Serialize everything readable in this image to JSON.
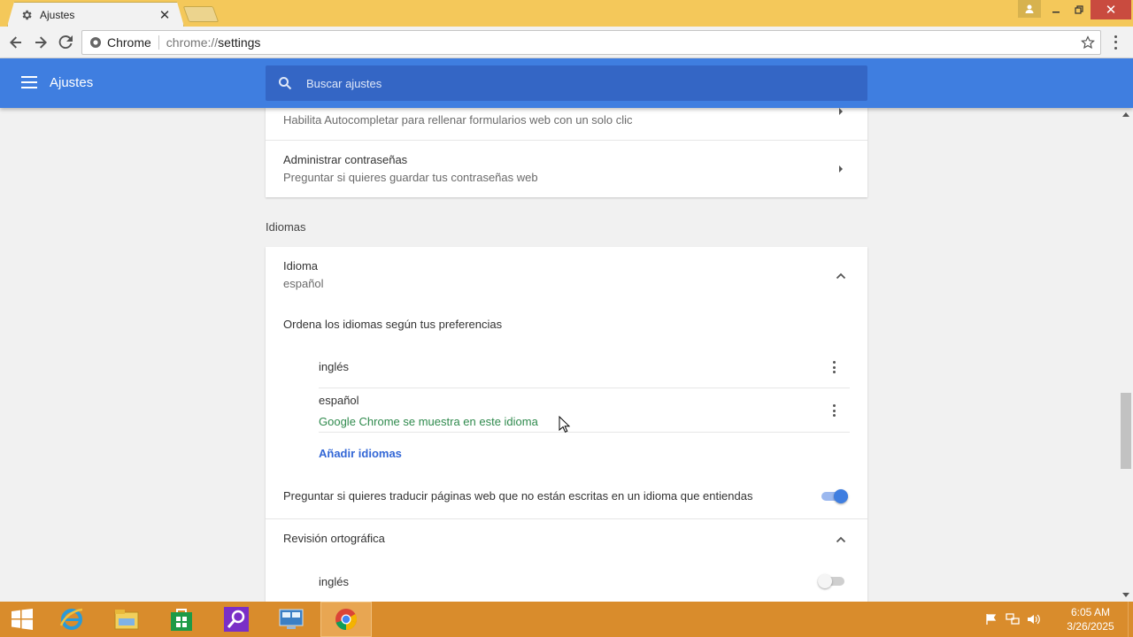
{
  "browser": {
    "tab_title": "Ajustes",
    "omnibox_scheme_label": "Chrome",
    "omnibox_url_prefix": "chrome://",
    "omnibox_url_path": "settings"
  },
  "header": {
    "title": "Ajustes",
    "search_placeholder": "Buscar ajustes"
  },
  "autofill": {
    "autocompletar_secondary": "Habilita Autocompletar para rellenar formularios web con un solo clic",
    "passwords_primary": "Administrar contraseñas",
    "passwords_secondary": "Preguntar si quieres guardar tus contraseñas web"
  },
  "languages": {
    "section_title": "Idiomas",
    "language_label": "Idioma",
    "language_value": "español",
    "order_text": "Ordena los idiomas según tus preferencias",
    "items": [
      {
        "name": "inglés",
        "note": ""
      },
      {
        "name": "español",
        "note": "Google Chrome se muestra en este idioma"
      }
    ],
    "add_languages": "Añadir idiomas",
    "translate_prompt": "Preguntar si quieres traducir páginas web que no están escritas en un idioma que entiendas",
    "translate_enabled": true,
    "spellcheck_label": "Revisión ortográfica",
    "spellcheck_items": [
      {
        "name": "inglés",
        "enabled": false
      }
    ]
  },
  "taskbar": {
    "clock_time": "6:05 AM",
    "clock_date": "3/26/2025"
  },
  "colors": {
    "header_blue": "#3f7ee0",
    "search_blue": "#3466c5",
    "link_blue": "#3367d6",
    "note_green": "#2f8a4d",
    "taskbar_orange": "#d98c2c",
    "titlebar_yellow": "#f4c85a"
  }
}
